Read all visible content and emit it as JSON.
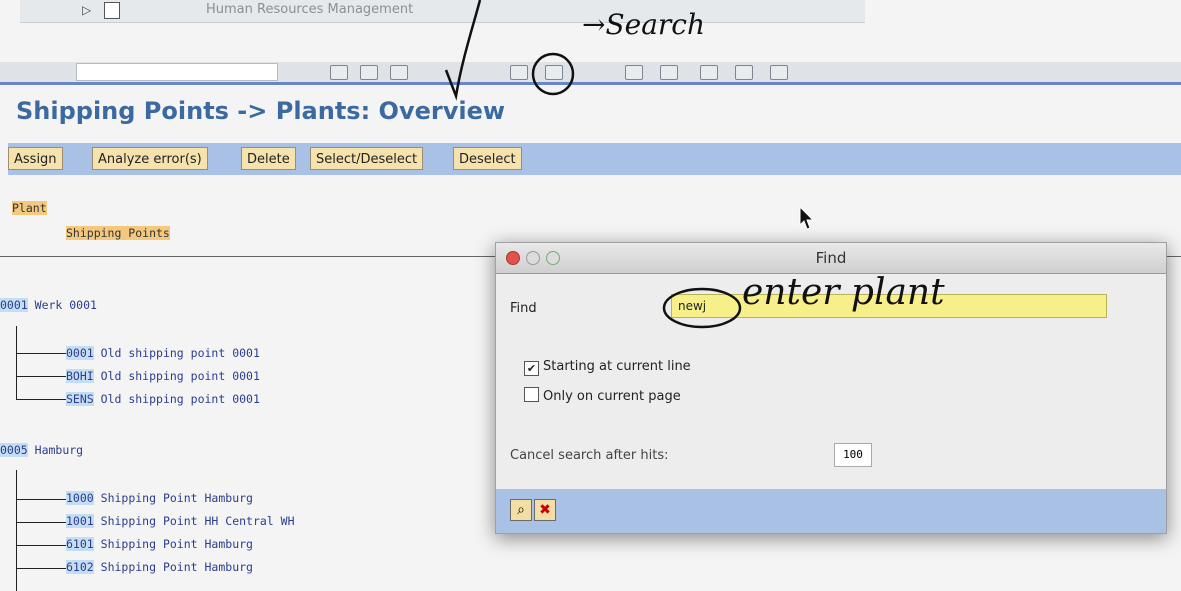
{
  "menu": {
    "human_resources": "Human Resources Management"
  },
  "title": "Shipping Points -> Plants: Overview",
  "toolbar": {
    "buttons": [
      "Assign",
      "Analyze error(s)",
      "Delete",
      "Select/Deselect",
      "Deselect"
    ]
  },
  "legend": {
    "plant": "Plant",
    "shipping_points": "Shipping Points"
  },
  "plants": [
    {
      "code": "0001",
      "name": "Werk 0001",
      "points": [
        {
          "code": "0001",
          "name": "Old shipping point 0001"
        },
        {
          "code": "BOHI",
          "name": "Old shipping point 0001"
        },
        {
          "code": "SENS",
          "name": "Old shipping point 0001"
        }
      ]
    },
    {
      "code": "0005",
      "name": "Hamburg",
      "points": [
        {
          "code": "1000",
          "name": "Shipping Point Hamburg"
        },
        {
          "code": "1001",
          "name": "Shipping Point HH Central WH"
        },
        {
          "code": "6101",
          "name": "Shipping Point Hamburg"
        },
        {
          "code": "6102",
          "name": "Shipping Point Hamburg"
        }
      ]
    }
  ],
  "find_dialog": {
    "title": "Find",
    "find_label": "Find",
    "find_value": "newj",
    "starting_current_line": "Starting at current line",
    "starting_checked": true,
    "only_current_page": "Only on current page",
    "only_checked": false,
    "cancel_hits_label": "Cancel search after hits:",
    "cancel_hits_value": "100"
  },
  "annotations": {
    "search": "→Search",
    "enter_plant": "enter plant"
  }
}
